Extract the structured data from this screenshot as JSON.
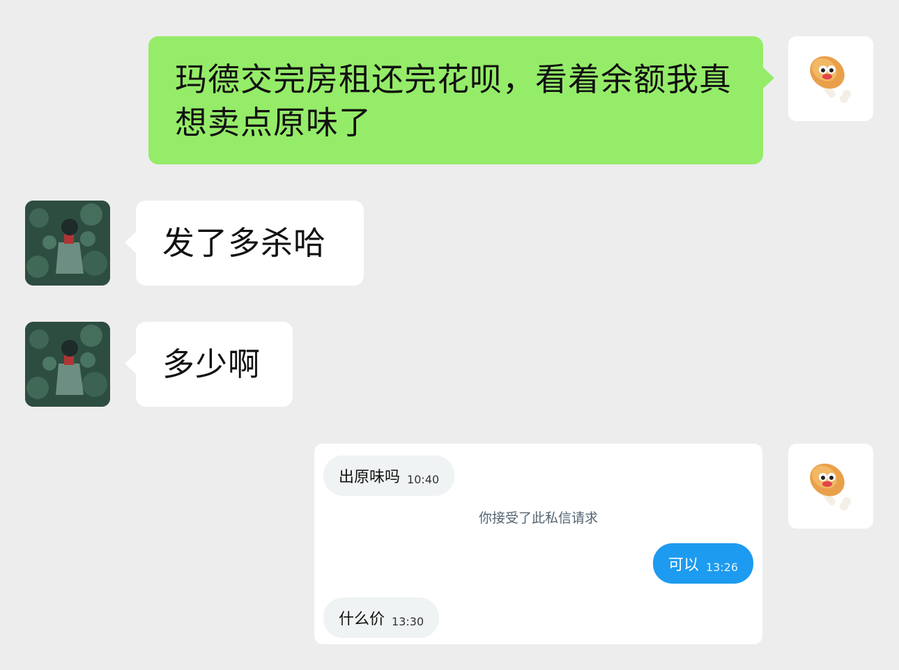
{
  "messages": [
    {
      "side": "right",
      "text": "玛德交完房租还完花呗，看着余额我真想卖点原味了"
    },
    {
      "side": "left",
      "text": "发了多杀哈"
    },
    {
      "side": "left",
      "text": "多少啊"
    }
  ],
  "avatars": {
    "self": "fried-chicken-drumstick-icon",
    "other": "person-in-foliage-avatar"
  },
  "screenshot": {
    "messages": [
      {
        "text": "出原味吗",
        "time": "10:40",
        "direction": "incoming"
      },
      {
        "text": "可以",
        "time": "13:26",
        "direction": "outgoing"
      },
      {
        "text": "什么价",
        "time": "13:30",
        "direction": "incoming"
      }
    ],
    "system_notice": "你接受了此私信请求"
  },
  "colors": {
    "background": "#ededed",
    "self_bubble": "#95ec69",
    "other_bubble": "#ffffff",
    "dm_outgoing": "#1d9bf0",
    "dm_incoming": "#eff3f4"
  }
}
